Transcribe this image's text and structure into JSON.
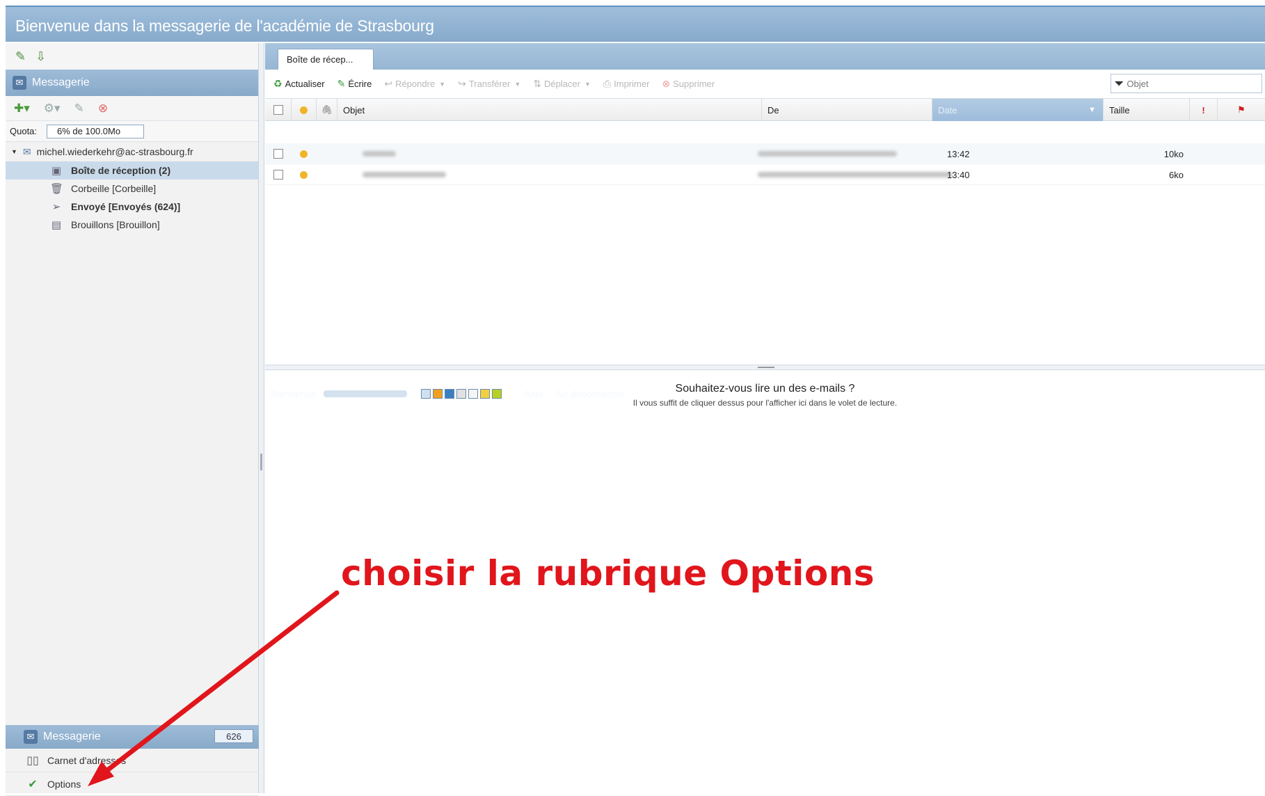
{
  "header": {
    "title": "Bienvenue dans la messagerie de l'académie de Strasbourg",
    "welcome": "Bienvenue",
    "help": "Aide",
    "logout": "Se déconnecter",
    "theme_colors": [
      "#cfe0f0",
      "#f0a020",
      "#3a7fc0",
      "#e0e0e0",
      "#f5f5f5",
      "#f0d040",
      "#b8d020"
    ]
  },
  "sidebar": {
    "title": "Messagerie",
    "quota_label": "Quota:",
    "quota_value": "6% de 100.0Mo",
    "account": "michel.wiederkehr@ac-strasbourg.fr",
    "folders": [
      {
        "label": "Boîte de réception (2)",
        "icon": "inbox-icon",
        "selected": true,
        "bold": true
      },
      {
        "label": "Corbeille [Corbeille]",
        "icon": "trash-icon",
        "selected": false,
        "bold": false
      },
      {
        "label": "Envoyé [Envoyés (624)]",
        "icon": "sent-icon",
        "selected": false,
        "bold": true
      },
      {
        "label": "Brouillons [Brouillon]",
        "icon": "drafts-icon",
        "selected": false,
        "bold": false
      }
    ]
  },
  "bottom_nav": {
    "title": "Messagerie",
    "count": "626",
    "items": [
      {
        "label": "Carnet d'adresses",
        "icon": "address-book-icon"
      },
      {
        "label": "Options",
        "icon": "options-check-icon"
      }
    ]
  },
  "tab": {
    "label": "Boîte de récep..."
  },
  "toolbar": {
    "refresh": "Actualiser",
    "compose": "Écrire",
    "reply": "Répondre",
    "forward": "Transférer",
    "move": "Déplacer",
    "print": "Imprimer",
    "delete": "Supprimer",
    "search_placeholder": "Objet"
  },
  "columns": {
    "subject": "Objet",
    "from": "De",
    "date": "Date",
    "size": "Taille"
  },
  "messages": [
    {
      "time": "13:42",
      "size": "10ko"
    },
    {
      "time": "13:40",
      "size": "6ko"
    }
  ],
  "preview": {
    "title": "Souhaitez-vous lire un des e-mails ?",
    "subtitle": "Il vous suffit de cliquer dessus pour l'afficher ici dans le volet de lecture."
  },
  "annotation": {
    "text": "choisir la rubrique Options",
    "color": "#e0161c"
  }
}
